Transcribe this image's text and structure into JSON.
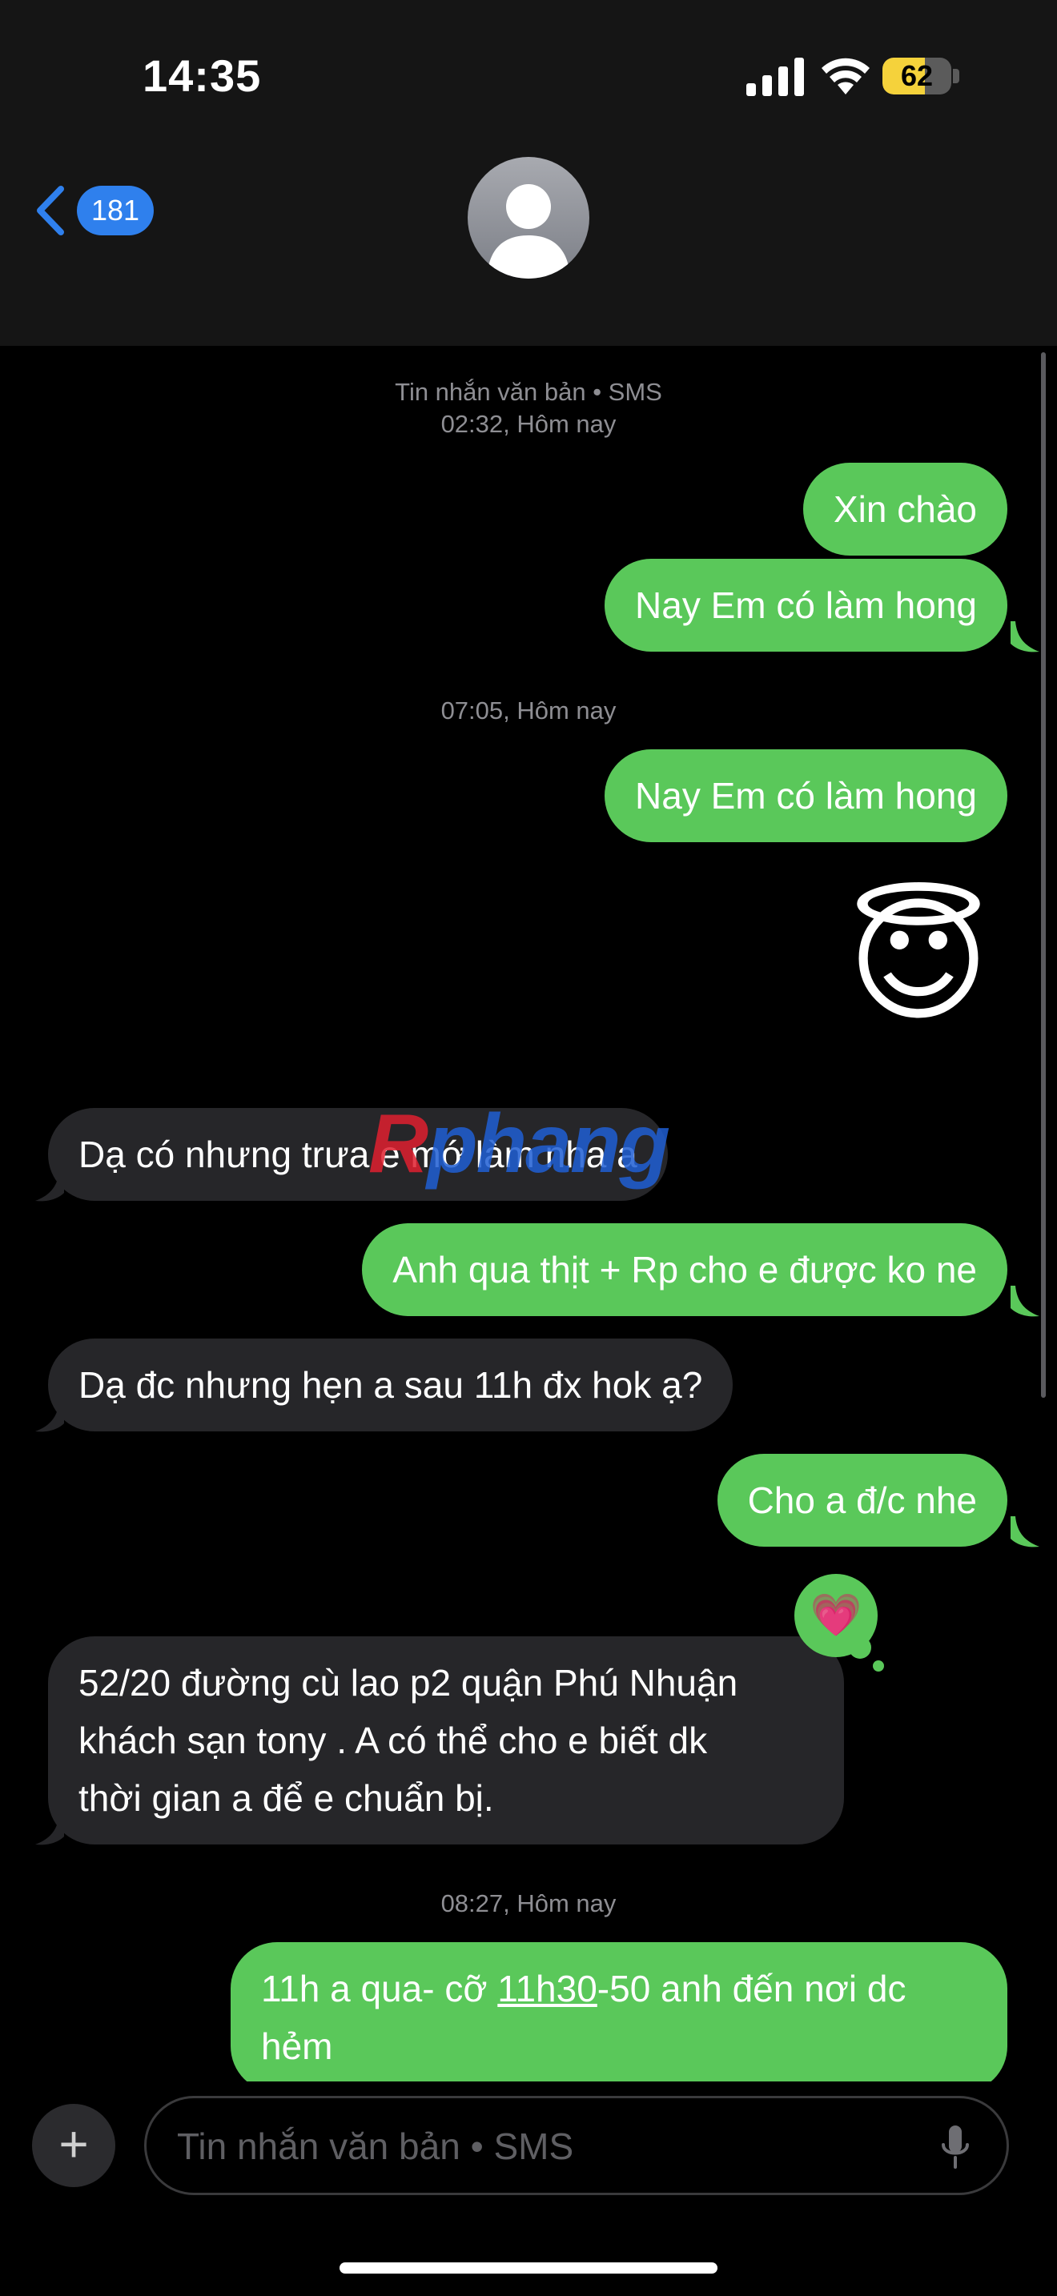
{
  "status_bar": {
    "time": "14:35",
    "battery": "62",
    "battery_level_percent": 62
  },
  "header": {
    "back_count": "181",
    "avatar_icon": "person-placeholder-icon"
  },
  "conversation": {
    "service_label": "Tin nhắn văn bản • SMS",
    "timestamps": [
      "02:32, Hôm nay",
      "07:05, Hôm nay",
      "08:27, Hôm nay"
    ],
    "messages": [
      {
        "from": "me",
        "text": "Xin chào"
      },
      {
        "from": "me",
        "text": "Nay Em có làm hong"
      },
      {
        "from": "me",
        "text": "Nay Em có làm hong"
      },
      {
        "from": "me",
        "emoji": "😇"
      },
      {
        "from": "them",
        "text": "Dạ có nhưng trưa e mớ làm nha a"
      },
      {
        "from": "me",
        "text": "Anh qua thịt + Rp cho e được ko ne"
      },
      {
        "from": "them",
        "text": "Dạ đc nhưng hẹn a sau 11h đx hok ạ?"
      },
      {
        "from": "me",
        "text": "Cho a đ/c nhe"
      },
      {
        "from": "them",
        "lines": [
          "52/20 đường cù lao p2 quận Phú Nhuận",
          "khách sạn tony . A có thể cho e biết dk",
          "thời gian a để e chuẩn bị."
        ],
        "tapback": "💗"
      },
      {
        "from": "me",
        "lines_parts": [
          "11h a qua- cỡ ",
          "11h30",
          "-50 anh đến nơi dc"
        ],
        "line2": "hẻm"
      }
    ]
  },
  "watermark": {
    "first": "R",
    "rest": "phang"
  },
  "composer": {
    "placeholder": "Tin nhắn văn bản • SMS",
    "plus": "+"
  },
  "colors": {
    "sent_bubble": "#5ac85a",
    "received_bubble": "#262629",
    "accent": "#2f80ed"
  }
}
